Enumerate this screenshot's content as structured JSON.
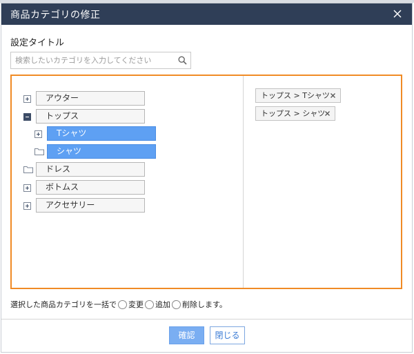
{
  "dialog": {
    "title": "商品カテゴリの修正"
  },
  "settings": {
    "label": "設定タイトル"
  },
  "search": {
    "placeholder": "検索したいカテゴリを入力してください"
  },
  "tree": {
    "items": [
      {
        "label": "アウター",
        "toggle": "plus",
        "selected": false
      },
      {
        "label": "トップス",
        "toggle": "minus",
        "selected": false
      },
      {
        "label": "Tシャツ",
        "toggle": "plus",
        "selected": true
      },
      {
        "label": "シャツ",
        "toggle": "none",
        "selected": true
      },
      {
        "label": "ドレス",
        "toggle": "none",
        "selected": false
      },
      {
        "label": "ボトムス",
        "toggle": "plus",
        "selected": false
      },
      {
        "label": "アクセサリー",
        "toggle": "plus",
        "selected": false
      }
    ]
  },
  "selected_tags": [
    {
      "label": "トップス > Tシャツ"
    },
    {
      "label": "トップス > シャツ"
    }
  ],
  "bulk": {
    "prefix": "選択した商品カテゴリを一括で",
    "option1": "変更",
    "option2": "追加",
    "option3": "削除します。"
  },
  "footer": {
    "confirm_label": "確認",
    "close_label": "閉じる"
  },
  "colors": {
    "header_bg": "#2f3e57",
    "panel_border": "#f08a24",
    "selected_bg": "#5ea0f3",
    "confirm_bg": "#7aaef2"
  },
  "icons": {
    "close": "close-icon",
    "search": "search-icon",
    "folder": "folder-icon",
    "plus": "plus-toggle-icon",
    "minus": "minus-toggle-icon",
    "remove": "remove-tag-icon"
  }
}
